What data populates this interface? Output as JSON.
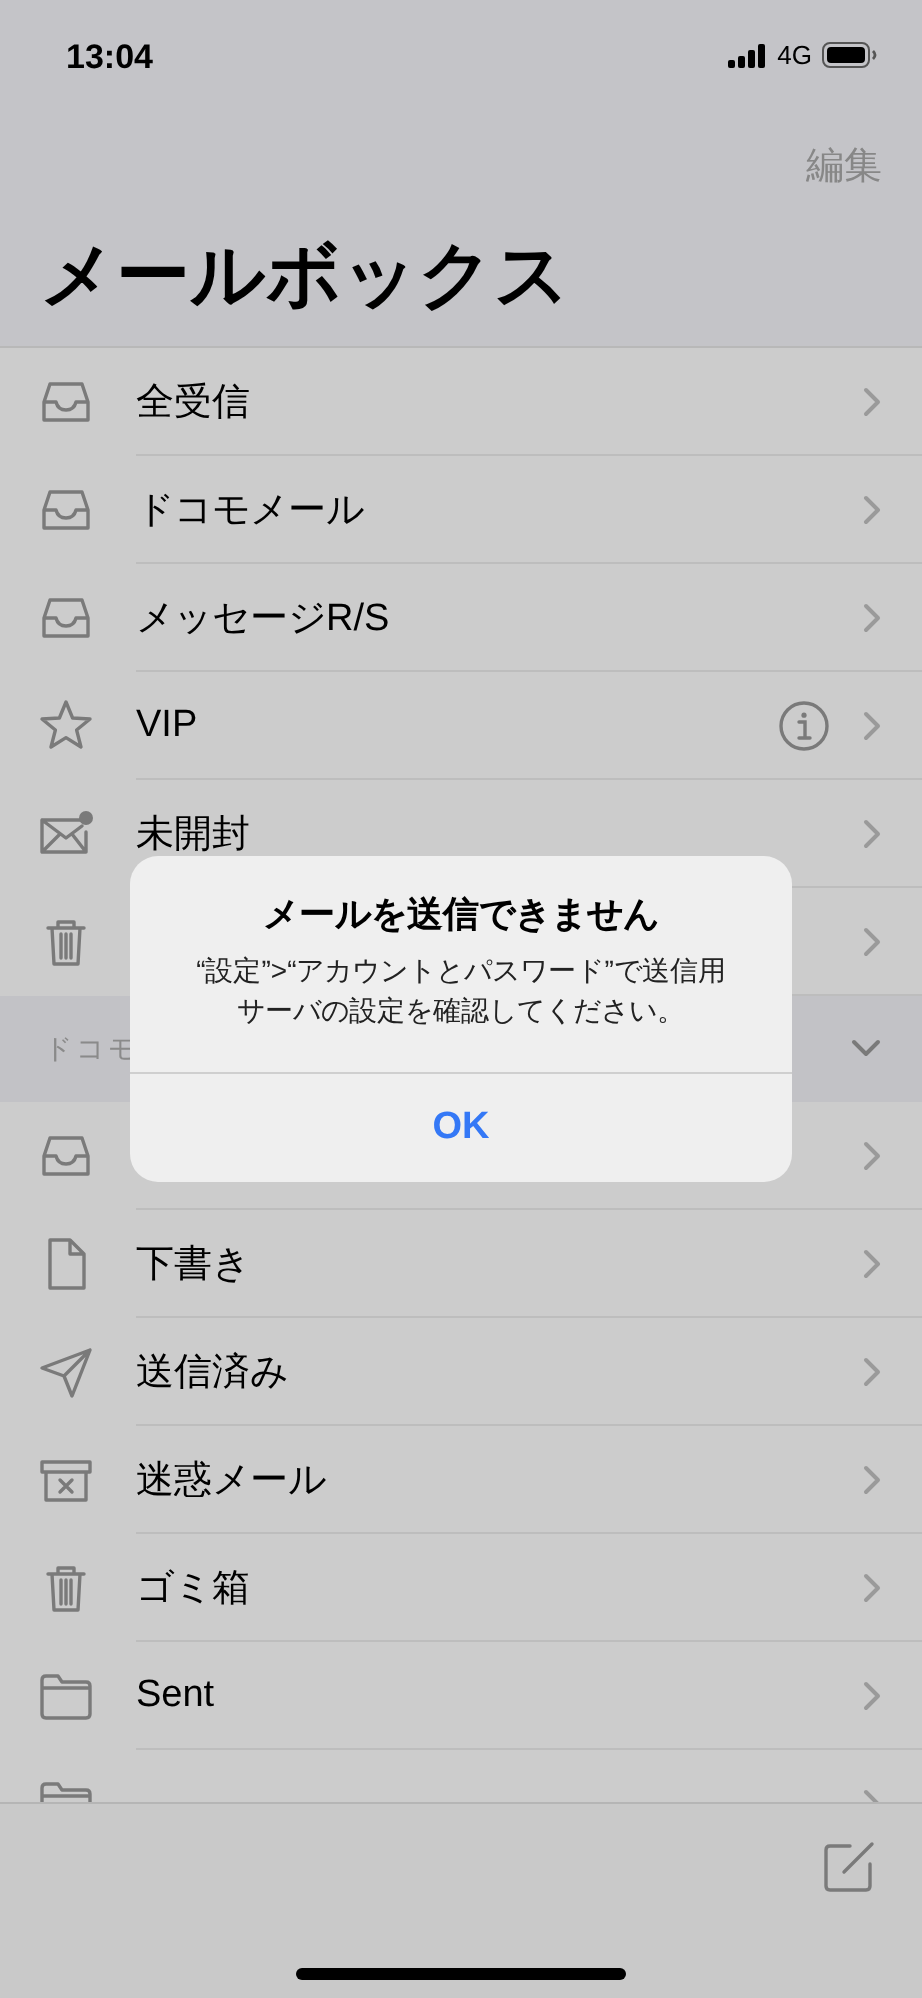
{
  "status_bar": {
    "time": "13:04",
    "network": "4G"
  },
  "nav": {
    "edit": "編集",
    "title": "メールボックス"
  },
  "mailboxes": [
    {
      "kind": "tray",
      "label": "全受信",
      "info": false
    },
    {
      "kind": "tray",
      "label": "ドコモメール",
      "info": false
    },
    {
      "kind": "tray",
      "label": "メッセージR/S",
      "info": false
    },
    {
      "kind": "star",
      "label": "VIP",
      "info": true
    },
    {
      "kind": "envelope-dot",
      "label": "未開封",
      "info": false
    },
    {
      "kind": "trash",
      "info": false
    }
  ],
  "account": {
    "name": "ドコモ",
    "expanded": true,
    "folders": [
      {
        "kind": "tray"
      },
      {
        "kind": "document",
        "label": "下書き"
      },
      {
        "kind": "paperplane",
        "label": "送信済み"
      },
      {
        "kind": "junk",
        "label": "迷惑メール"
      },
      {
        "kind": "trash",
        "label": "ゴミ箱"
      },
      {
        "kind": "folder",
        "label": "Sent"
      },
      {
        "kind": "folder"
      }
    ]
  },
  "alert": {
    "title": "メールを送信できません",
    "message": "“設定”>“アカウントとパスワード”で送信用サーバの設定を確認してください。",
    "button": "OK"
  }
}
